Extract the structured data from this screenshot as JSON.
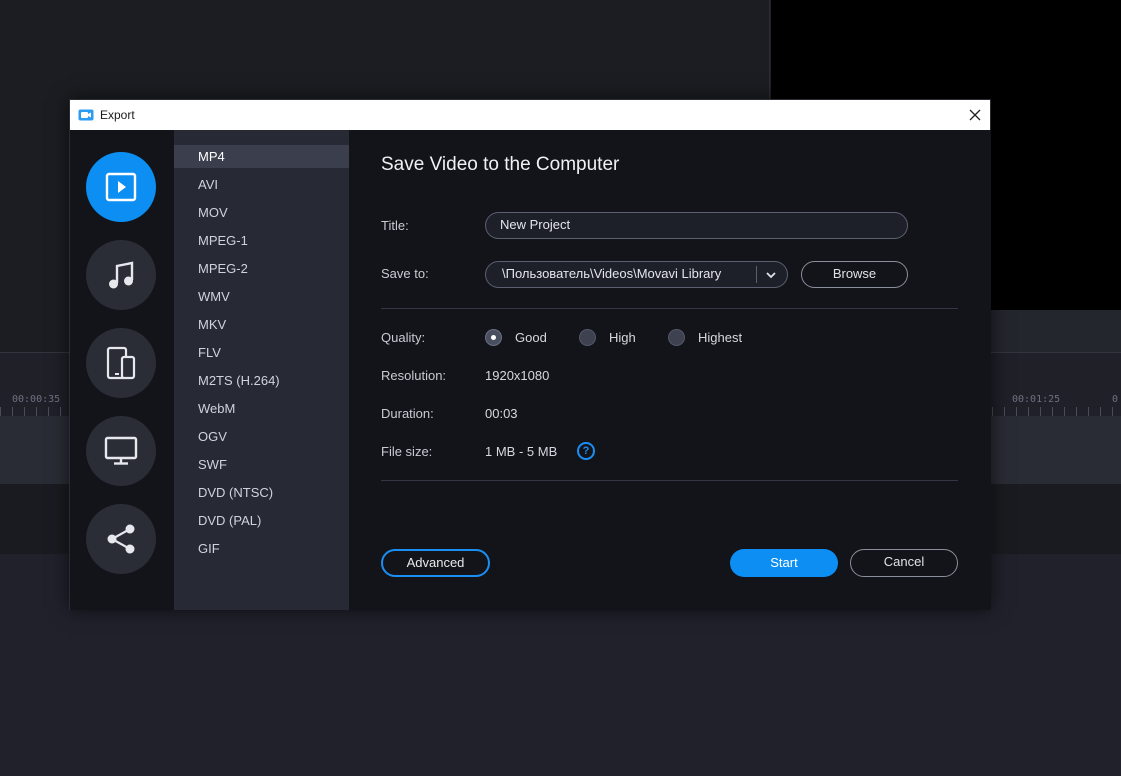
{
  "background": {
    "ruler_left": "00:00:35",
    "ruler_right": "00:01:25",
    "ruler_right2": "0"
  },
  "dialog": {
    "title": "Export",
    "categories": [
      {
        "icon": "play-video-icon"
      },
      {
        "icon": "music-note-icon"
      },
      {
        "icon": "devices-icon"
      },
      {
        "icon": "monitor-icon"
      },
      {
        "icon": "share-icon"
      }
    ],
    "formats": [
      "MP4",
      "AVI",
      "MOV",
      "MPEG-1",
      "MPEG-2",
      "WMV",
      "MKV",
      "FLV",
      "M2TS (H.264)",
      "WebM",
      "OGV",
      "SWF",
      "DVD (NTSC)",
      "DVD (PAL)",
      "GIF"
    ],
    "selected_format": "MP4",
    "heading": "Save Video to the Computer",
    "title_label": "Title:",
    "title_value": "New Project",
    "save_to_label": "Save to:",
    "save_to_value": "\\Пользователь\\Videos\\Movavi Library",
    "browse_label": "Browse",
    "quality_label": "Quality:",
    "quality_options": [
      "Good",
      "High",
      "Highest"
    ],
    "quality_selected": "Good",
    "resolution_label": "Resolution:",
    "resolution_value": "1920x1080",
    "duration_label": "Duration:",
    "duration_value": "00:03",
    "filesize_label": "File size:",
    "filesize_value": "1 MB - 5 MB",
    "help_glyph": "?",
    "advanced_label": "Advanced",
    "start_label": "Start",
    "cancel_label": "Cancel"
  },
  "colors": {
    "accent": "#0c8ef3",
    "dialog_bg": "#131419",
    "format_list_bg": "#272a35"
  }
}
